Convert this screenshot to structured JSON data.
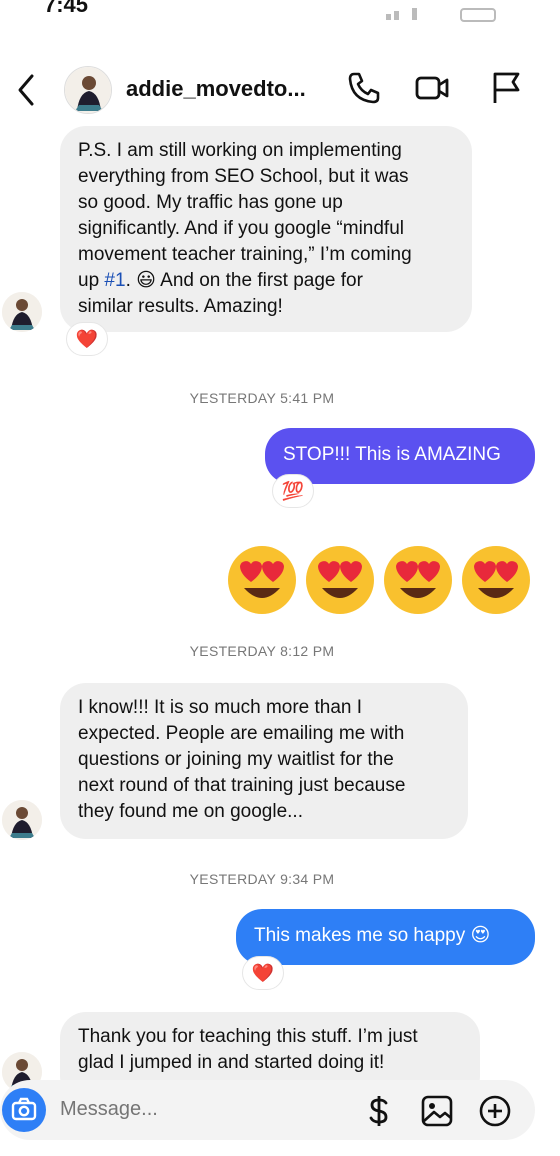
{
  "status_bar": {
    "time": "7:45"
  },
  "header": {
    "username": "addie_movedto..."
  },
  "messages": {
    "m1_lines": [
      "P.S. I am still working on implementing",
      "everything from SEO School, but it was",
      "so good. My traffic has gone up",
      "significantly. And if you google “mindful",
      "movement teacher training,” I’m coming"
    ],
    "m1_last_pre": "up ",
    "m1_link": "#1",
    "m1_last_post": ". 😃 And on the first page for",
    "m1_final": "similar results. Amazing!",
    "m1_reaction": "❤️",
    "ts1": "YESTERDAY 5:41 PM",
    "m2": "STOP!!! This is AMAZING",
    "m2_reaction": "💯",
    "ts2": "YESTERDAY 8:12 PM",
    "m3_lines": [
      "I know!!! It is so much more than I",
      "expected. People are emailing me with",
      "questions or joining my waitlist for the",
      "next round of that training just because",
      "they found me on google..."
    ],
    "ts3": "YESTERDAY 9:34 PM",
    "m4": "This makes me so happy 😍",
    "m4_reaction": "❤️",
    "m5_lines": [
      "Thank you for teaching this stuff. I’m just",
      "glad I jumped in and started doing it!"
    ]
  },
  "composer": {
    "placeholder": "Message..."
  },
  "colors": {
    "outgoing_purple": "#5b51f0",
    "outgoing_blue": "#2e7ff6",
    "incoming": "#efefef"
  }
}
